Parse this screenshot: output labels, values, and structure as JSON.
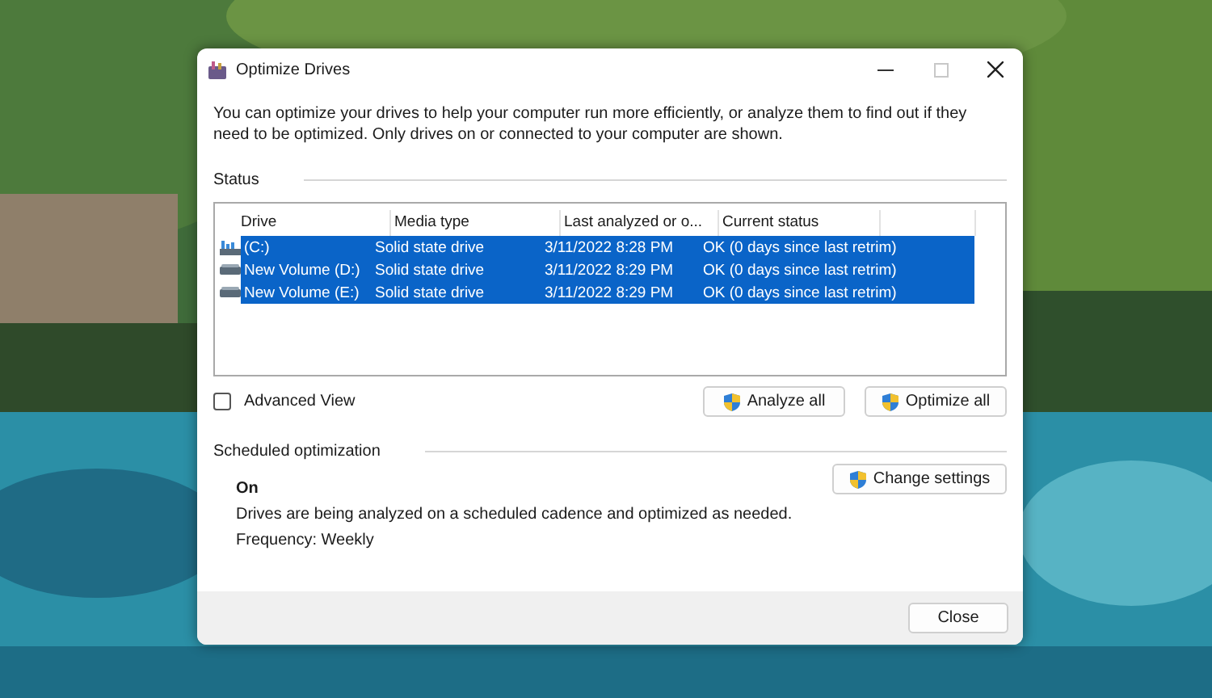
{
  "window": {
    "title": "Optimize Drives"
  },
  "description": "You can optimize your drives to help your computer run more efficiently, or analyze them to find out if they need to be optimized. Only drives on or connected to your computer are shown.",
  "status": {
    "label": "Status",
    "columns": [
      "Drive",
      "Media type",
      "Last analyzed or o...",
      "Current status"
    ],
    "rows": [
      {
        "drive": "(C:)",
        "kind": "system",
        "media_type": "Solid state drive",
        "last_analyzed": "3/11/2022 8:28 PM",
        "current_status": "OK (0 days since last retrim)",
        "selected": true
      },
      {
        "drive": "New Volume (D:)",
        "kind": "volume",
        "media_type": "Solid state drive",
        "last_analyzed": "3/11/2022 8:29 PM",
        "current_status": "OK (0 days since last retrim)",
        "selected": true
      },
      {
        "drive": "New Volume (E:)",
        "kind": "volume",
        "media_type": "Solid state drive",
        "last_analyzed": "3/11/2022 8:29 PM",
        "current_status": "OK (0 days since last retrim)",
        "selected": true
      }
    ]
  },
  "advanced_view": {
    "label": "Advanced View",
    "checked": false
  },
  "buttons": [
    "Analyze all",
    "Optimize all"
  ],
  "scheduled": {
    "label": "Scheduled optimization",
    "state": "On",
    "description": "Drives are being analyzed on a scheduled cadence and optimized as needed.",
    "frequency": "Frequency: Weekly",
    "button": "Change settings"
  },
  "footer": {
    "button": "Close"
  }
}
